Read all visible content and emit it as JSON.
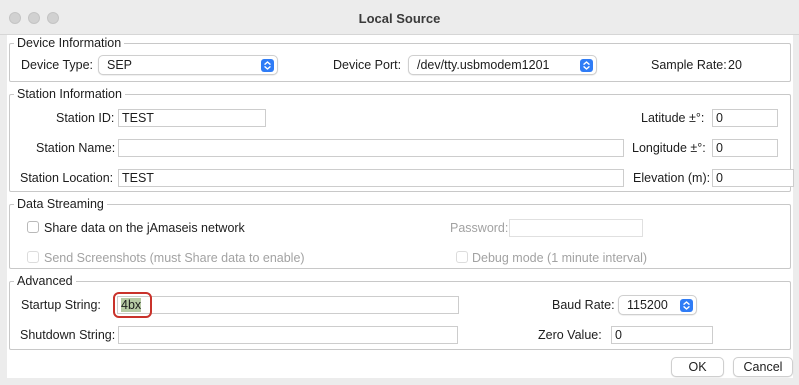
{
  "window": {
    "title": "Local Source"
  },
  "device_info": {
    "legend": "Device Information",
    "device_type_label": "Device Type:",
    "device_type_value": "SEP",
    "device_port_label": "Device Port:",
    "device_port_value": "/dev/tty.usbmodem1201",
    "sample_rate_label": "Sample Rate:",
    "sample_rate_value": "20"
  },
  "station_info": {
    "legend": "Station Information",
    "station_id_label": "Station ID:",
    "station_id_value": "TEST",
    "latitude_label": "Latitude ±°:",
    "latitude_value": "0",
    "station_name_label": "Station Name:",
    "station_name_value": "",
    "longitude_label": "Longitude ±°:",
    "longitude_value": "0",
    "station_location_label": "Station Location:",
    "station_location_value": "TEST",
    "elevation_label": "Elevation (m):",
    "elevation_value": "0"
  },
  "data_streaming": {
    "legend": "Data Streaming",
    "share_label": "Share data on the jAmaseis network",
    "password_label": "Password:",
    "password_value": "",
    "screenshots_label": "Send Screenshots (must Share data to enable)",
    "debug_label": "Debug mode (1 minute interval)"
  },
  "advanced": {
    "legend": "Advanced",
    "startup_label": "Startup String:",
    "startup_value": "4bx",
    "baud_label": "Baud Rate:",
    "baud_value": "115200",
    "shutdown_label": "Shutdown String:",
    "shutdown_value": "",
    "zero_label": "Zero Value:",
    "zero_value": "0"
  },
  "buttons": {
    "ok": "OK",
    "cancel": "Cancel"
  },
  "colors": {
    "accent": "#2f7cf6",
    "highlight_ring": "#c9322b",
    "selection": "#b7cba5"
  }
}
